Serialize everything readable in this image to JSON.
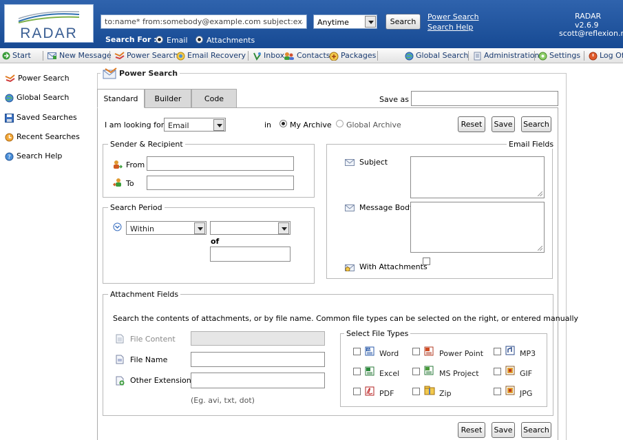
{
  "header": {
    "logo_text": "RADAR",
    "search_value": "to:name* from:somebody@example.com subject:example",
    "period_value": "Anytime",
    "search_button": "Search",
    "power_search_link": "Power Search",
    "search_help_link": "Search Help",
    "search_for_label": "Search For :",
    "email_option": "Email",
    "attachments_option": "Attachments",
    "version": "RADAR v2.6.9",
    "user": "scott@reflexion.net"
  },
  "toolbar": {
    "start": "Start",
    "new_message": "New Message",
    "power_search": "Power Search",
    "email_recovery": "Email Recovery",
    "inbox": "Inbox",
    "contacts": "Contacts",
    "packages": "Packages",
    "global_search": "Global Search",
    "administration": "Administration",
    "settings": "Settings",
    "log_off": "Log Off"
  },
  "sidebar": {
    "items": [
      {
        "label": "Power Search",
        "icon": "power-search-icon"
      },
      {
        "label": "Global Search",
        "icon": "globe-icon"
      },
      {
        "label": "Saved Searches",
        "icon": "floppy-icon"
      },
      {
        "label": "Recent Searches",
        "icon": "clock-icon"
      },
      {
        "label": "Search Help",
        "icon": "help-icon"
      }
    ]
  },
  "main": {
    "title": "Power Search",
    "tabs": [
      "Standard",
      "Builder",
      "Code"
    ],
    "save_as_label": "Save as",
    "looking_for_label": "I am looking for:",
    "looking_for_value": "Email",
    "in_label": "in",
    "my_archive": "My Archive",
    "global_archive": "Global Archive",
    "reset": "Reset",
    "save": "Save",
    "search": "Search",
    "sender_recipient": {
      "legend": "Sender & Recipient",
      "from_label": "From",
      "to_label": "To"
    },
    "search_period": {
      "legend": "Search Period",
      "within_value": "Within",
      "of_label": "of"
    },
    "email_fields": {
      "legend": "Email Fields",
      "subject_label": "Subject",
      "body_label": "Message Body",
      "attachments_label": "With Attachments"
    },
    "attachment_fields": {
      "legend": "Attachment Fields",
      "description": "Search the contents of attachments, or by file name. Common file types can be selected on the right, or entered manually",
      "file_content_label": "File Content",
      "file_name_label": "File Name",
      "other_extension_label": "Other Extension",
      "example_hint": "(Eg. avi, txt, dot)",
      "file_types_legend": "Select File Types",
      "file_types": [
        "Word",
        "Power Point",
        "MP3",
        "Excel",
        "MS Project",
        "GIF",
        "PDF",
        "Zip",
        "JPG"
      ]
    }
  },
  "colors": {
    "header_bg": "#1f55a0",
    "toolbar_text": "#1a3b70"
  }
}
